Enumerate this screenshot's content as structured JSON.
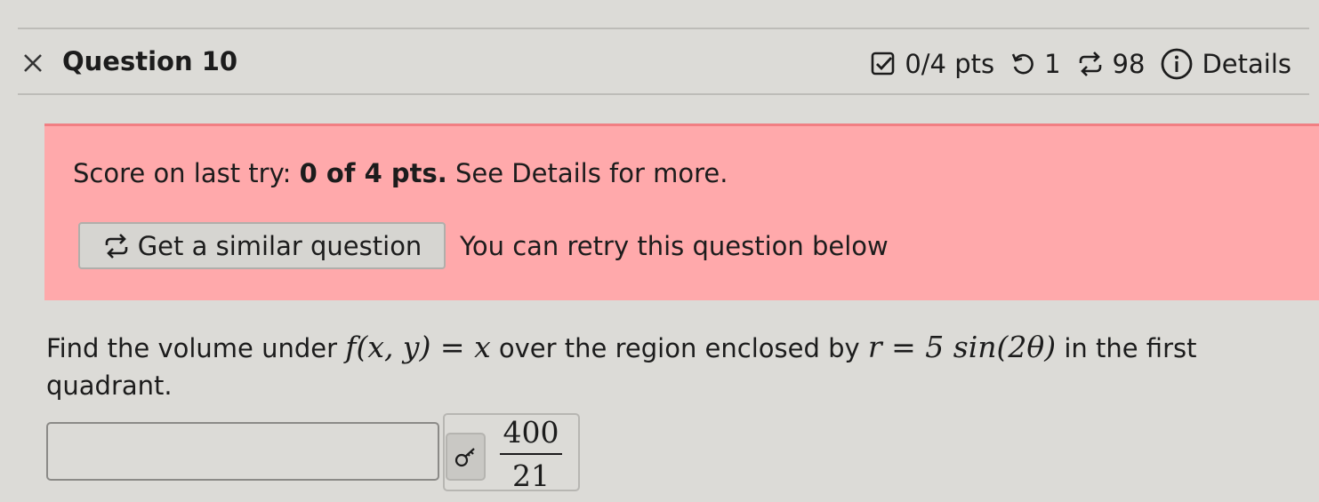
{
  "header": {
    "title": "Question 10",
    "score": "0/4 pts",
    "retries": "1",
    "similar_count": "98",
    "details_label": "Details"
  },
  "alert": {
    "score_prefix": "Score on last try: ",
    "score_bold": "0 of 4 pts.",
    "score_suffix": " See Details for more.",
    "similar_button_label": "Get a similar question",
    "retry_text": "You can retry this question below"
  },
  "question": {
    "text_1": "Find the volume under ",
    "math_1": "f(x, y) = x",
    "text_2": " over the region enclosed by ",
    "math_2": "r = 5 sin(2θ)",
    "text_3": " in the first quadrant."
  },
  "answer": {
    "value": "",
    "placeholder": "",
    "key_numerator": "400",
    "key_denominator": "21"
  },
  "colors": {
    "background": "#dcdbd7",
    "alert_bg": "#ffa9ab",
    "alert_border": "#f17f83"
  },
  "icons": [
    "close-icon",
    "checkbox-icon",
    "retry-icon",
    "similar-icon",
    "info-icon",
    "key-icon"
  ]
}
